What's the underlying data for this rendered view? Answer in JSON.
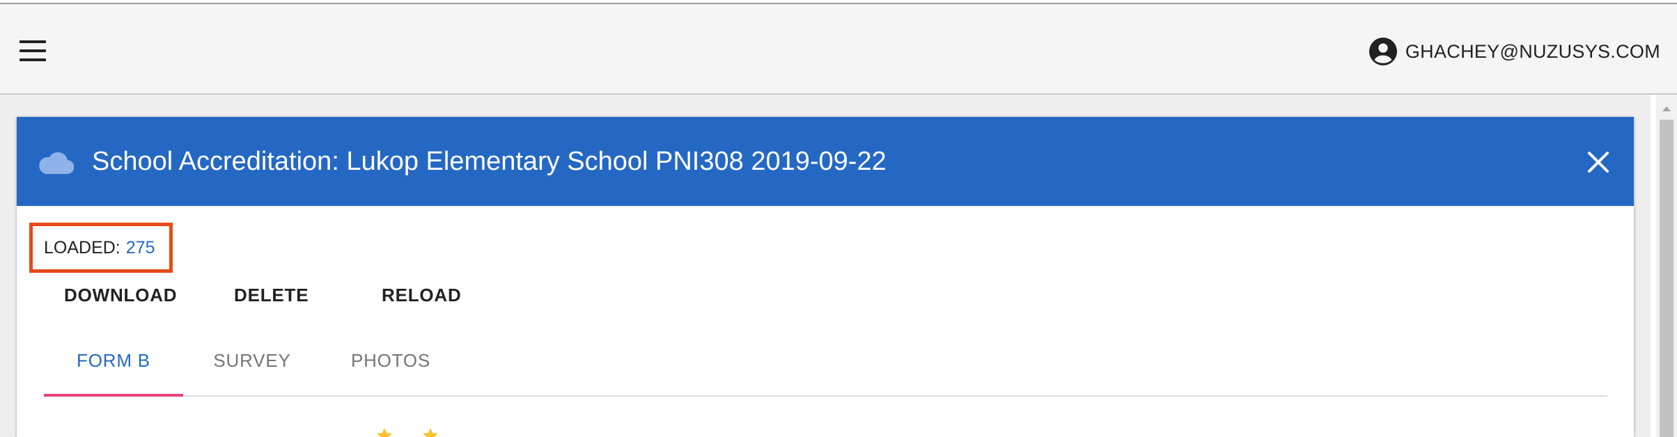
{
  "appbar": {
    "menu_icon": "hamburger-menu-icon",
    "user_icon": "account-circle-icon",
    "user_email": "GHACHEY@NUZUSYS.COM"
  },
  "card": {
    "header_icon": "cloud-icon",
    "title": "School Accreditation: Lukop Elementary School PNI308 2019-09-22",
    "close_icon": "close-icon",
    "header_color": "#2568c4"
  },
  "status": {
    "loaded_label": "LOADED:",
    "loaded_value": "275",
    "highlight_color": "#e64a19"
  },
  "actions": {
    "download_label": "DOWNLOAD",
    "delete_label": "DELETE",
    "reload_label": "RELOAD"
  },
  "tabs": [
    {
      "label": "FORM B",
      "active": true
    },
    {
      "label": "SURVEY",
      "active": false
    },
    {
      "label": "PHOTOS",
      "active": false
    }
  ],
  "colors": {
    "accent": "#2568c4",
    "tab_indicator": "#ec407a",
    "star": "#fbc02d"
  }
}
